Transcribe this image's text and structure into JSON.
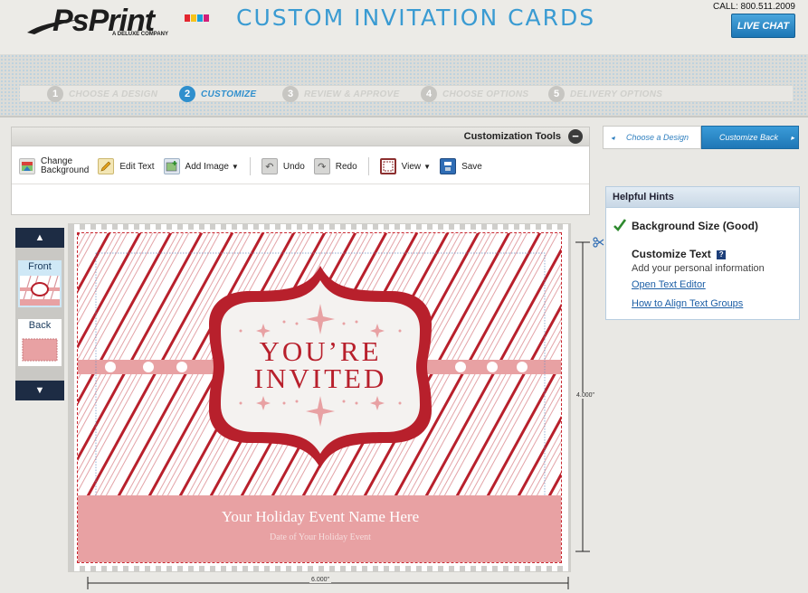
{
  "header": {
    "logo_text": "PsPrint",
    "logo_sub": "A DELUXE COMPANY",
    "page_title": "CUSTOM INVITATION CARDS",
    "call": "CALL: 800.511.2009",
    "live_chat": "LIVE CHAT"
  },
  "steps": [
    {
      "num": "1",
      "label": "CHOOSE A DESIGN"
    },
    {
      "num": "2",
      "label": "CUSTOMIZE"
    },
    {
      "num": "3",
      "label": "REVIEW & APPROVE"
    },
    {
      "num": "4",
      "label": "CHOOSE OPTIONS"
    },
    {
      "num": "5",
      "label": "DELIVERY OPTIONS"
    }
  ],
  "tools": {
    "title": "Customization Tools",
    "collapse": "−",
    "change_bg_1": "Change",
    "change_bg_2": "Background",
    "edit_text": "Edit Text",
    "add_image": "Add Image",
    "undo": "Undo",
    "redo": "Redo",
    "view": "View",
    "save": "Save"
  },
  "nav": {
    "prev": "Choose a Design",
    "next": "Customize Back"
  },
  "hints": {
    "title": "Helpful Hints",
    "bg_size": "Background Size (Good)",
    "customize_text": "Customize Text",
    "customize_desc": "Add your personal information",
    "open_editor": "Open Text Editor",
    "align_groups": "How to Align Text Groups"
  },
  "thumbs": {
    "front": "Front",
    "back": "Back"
  },
  "card": {
    "line1": "YOU’RE",
    "line2": "INVITED",
    "event_name": "Your Holiday Event Name Here",
    "event_date": "Date of Your Holiday Event"
  },
  "dimensions": {
    "height": "4.000\"",
    "width": "6.000\""
  },
  "colors": {
    "brand_blue": "#3a9bd2",
    "card_red": "#b8202c",
    "card_pink": "#e8a1a3"
  }
}
